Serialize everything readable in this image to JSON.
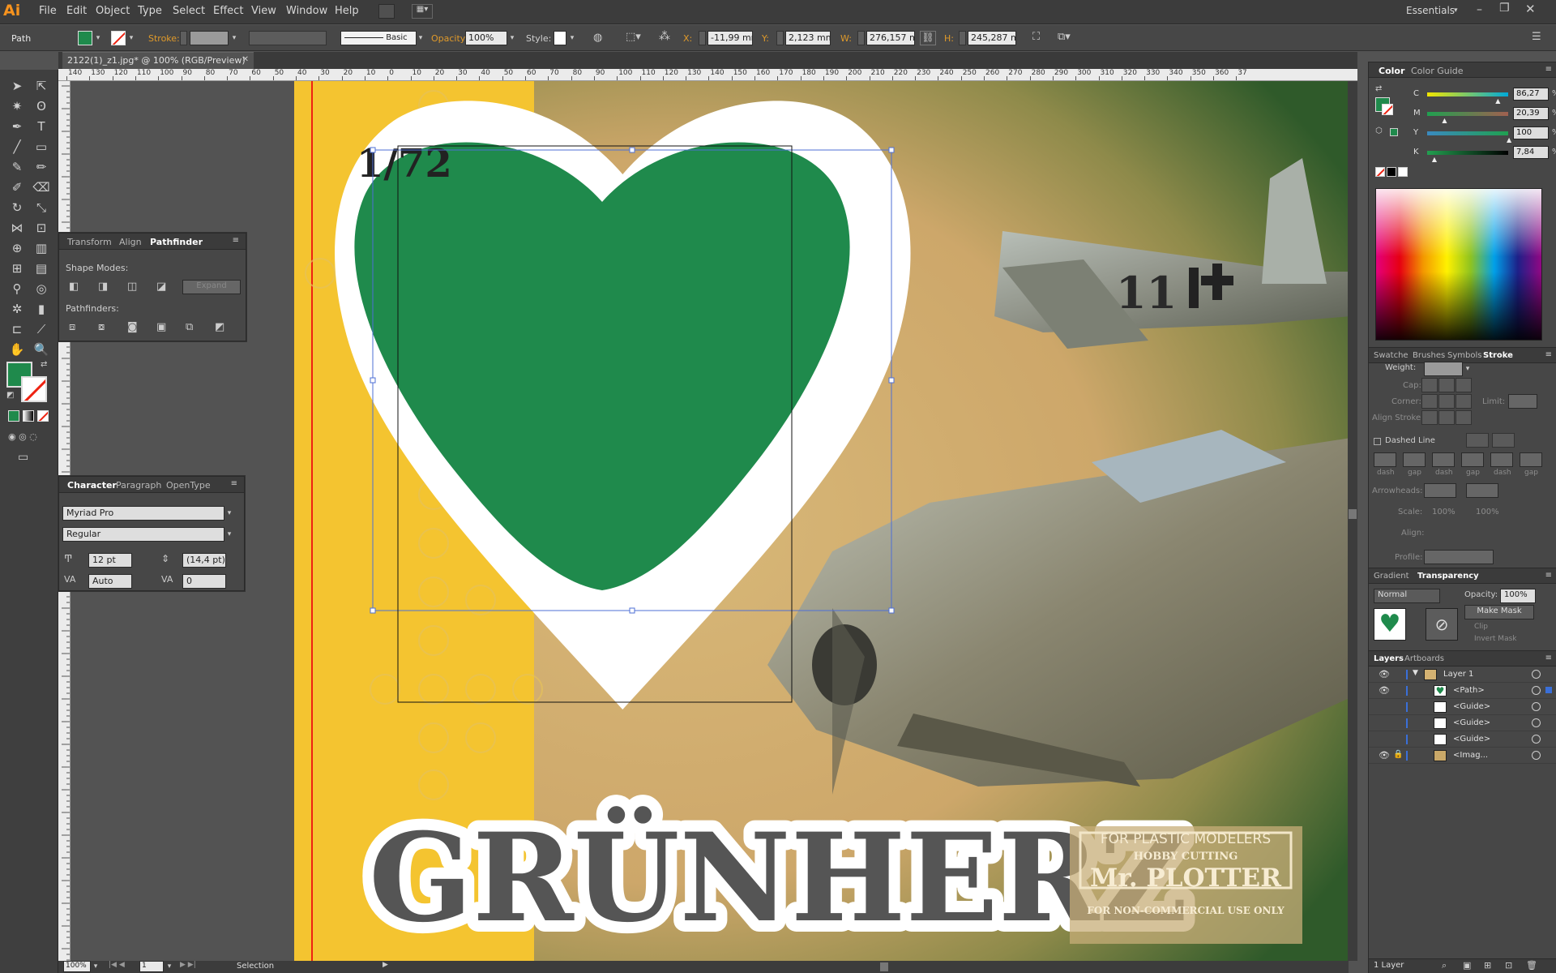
{
  "app": {
    "logo": "Ai",
    "workspace": "Essentials"
  },
  "menu": [
    "File",
    "Edit",
    "Object",
    "Type",
    "Select",
    "Effect",
    "View",
    "Window",
    "Help"
  ],
  "control": {
    "path_label": "Path",
    "stroke_label": "Stroke:",
    "brush_label": "Basic",
    "opacity_label": "Opacity:",
    "opacity_value": "100%",
    "style_label": "Style:",
    "x_label": "X:",
    "x_value": "-11,99 mm",
    "y_label": "Y:",
    "y_value": "2,123 mm",
    "w_label": "W:",
    "w_value": "276,157 mm",
    "h_label": "H:",
    "h_value": "245,287 mm"
  },
  "document": {
    "tab_title": "2122(1)_z1.jpg* @ 100% (RGB/Preview)",
    "zoom": "100%",
    "artboard_number": "1",
    "status_tool": "Selection"
  },
  "ruler": {
    "ticks": [
      "140",
      "130",
      "120",
      "110",
      "100",
      "90",
      "80",
      "70",
      "60",
      "50",
      "40",
      "30",
      "20",
      "10",
      "0",
      "10",
      "20",
      "30",
      "40",
      "50",
      "60",
      "70",
      "80",
      "90",
      "100",
      "110",
      "120",
      "130",
      "140",
      "150",
      "160",
      "170",
      "180",
      "190",
      "200",
      "210",
      "220",
      "230",
      "240",
      "250",
      "260",
      "270",
      "280",
      "290",
      "300",
      "310",
      "320",
      "330",
      "340",
      "350",
      "360",
      "37"
    ]
  },
  "artwork": {
    "scale_text": "1/72",
    "title_text": "GRÜNHERZ",
    "plane_marking": "11",
    "watermark": {
      "line1": "FOR PLASTIC MODELERS",
      "line2": "HOBBY CUTTING",
      "line3": "Mr. PLOTTER",
      "line4": "FOR NON-COMMERCIAL USE ONLY"
    },
    "heart_color": "#1f8a4c",
    "bg_yellow": "#f4c430",
    "bg_tan": "#d4b272"
  },
  "pathfinder": {
    "tabs": [
      "Transform",
      "Align",
      "Pathfinder"
    ],
    "shape_modes_label": "Shape Modes:",
    "expand_label": "Expand",
    "pathfinders_label": "Pathfinders:"
  },
  "character": {
    "tabs": [
      "Character",
      "Paragraph",
      "OpenType"
    ],
    "font": "Myriad Pro",
    "style": "Regular",
    "size": "12 pt",
    "leading": "(14,4 pt)",
    "kerning": "Auto",
    "tracking": "0"
  },
  "color_panel": {
    "tabs": [
      "Color",
      "Color Guide"
    ],
    "c": {
      "label": "C",
      "value": "86,27",
      "fraction": 0.8627,
      "color": "#00a8d8"
    },
    "m": {
      "label": "M",
      "value": "20,39",
      "fraction": 0.2039,
      "color": "#d4006e"
    },
    "y": {
      "label": "Y",
      "value": "100",
      "fraction": 1.0,
      "color": "#f2e600"
    },
    "k": {
      "label": "K",
      "value": "7,84",
      "fraction": 0.0784,
      "color": "#000000"
    },
    "pct": "%"
  },
  "stroke_panel": {
    "tabs": [
      "Swatche",
      "Brushes",
      "Symbols",
      "Stroke"
    ],
    "weight_label": "Weight:",
    "cap_label": "Cap:",
    "corner_label": "Corner:",
    "limit_label": "Limit:",
    "align_label": "Align Stroke:",
    "dashed_label": "Dashed Line",
    "dash_labels": [
      "dash",
      "gap",
      "dash",
      "gap",
      "dash",
      "gap"
    ],
    "arrowheads_label": "Arrowheads:",
    "scale_label": "Scale:",
    "scale_v1": "100%",
    "scale_v2": "100%",
    "align2_label": "Align:",
    "profile_label": "Profile:"
  },
  "transparency": {
    "tabs": [
      "Gradient",
      "Transparency"
    ],
    "mode": "Normal",
    "opacity_label": "Opacity:",
    "opacity_value": "100%",
    "make_mask": "Make Mask",
    "clip": "Clip",
    "invert": "Invert Mask"
  },
  "layers": {
    "tabs": [
      "Layers",
      "Artboards"
    ],
    "rows": [
      "Layer 1",
      "<Path>",
      "<Guide>",
      "<Guide>",
      "<Guide>",
      "<Imag..."
    ],
    "count": "1 Layer"
  }
}
